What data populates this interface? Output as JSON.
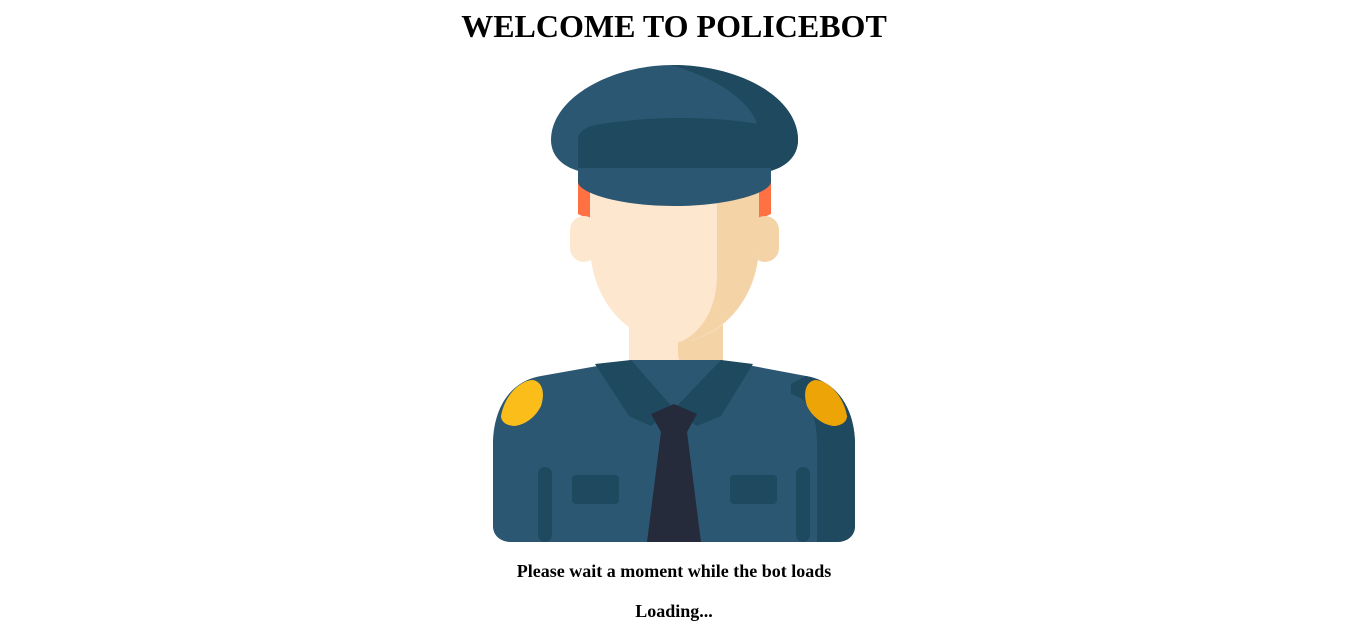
{
  "header": {
    "title": "WELCOME TO POLICEBOT"
  },
  "illustration": {
    "icon": "police-officer-avatar-icon",
    "colors": {
      "uniform": "#2C5772",
      "uniform_dark": "#1E495E",
      "skin": "#FDE7CF",
      "skin_shadow": "#F4D3A7",
      "hair": "#FF7043",
      "tie": "#262B3B",
      "epaulette": "#FBBD1A",
      "epaulette_dark": "#EDA407"
    }
  },
  "status": {
    "message": "Please wait a moment while the bot loads",
    "loading_text": "Loading..."
  }
}
